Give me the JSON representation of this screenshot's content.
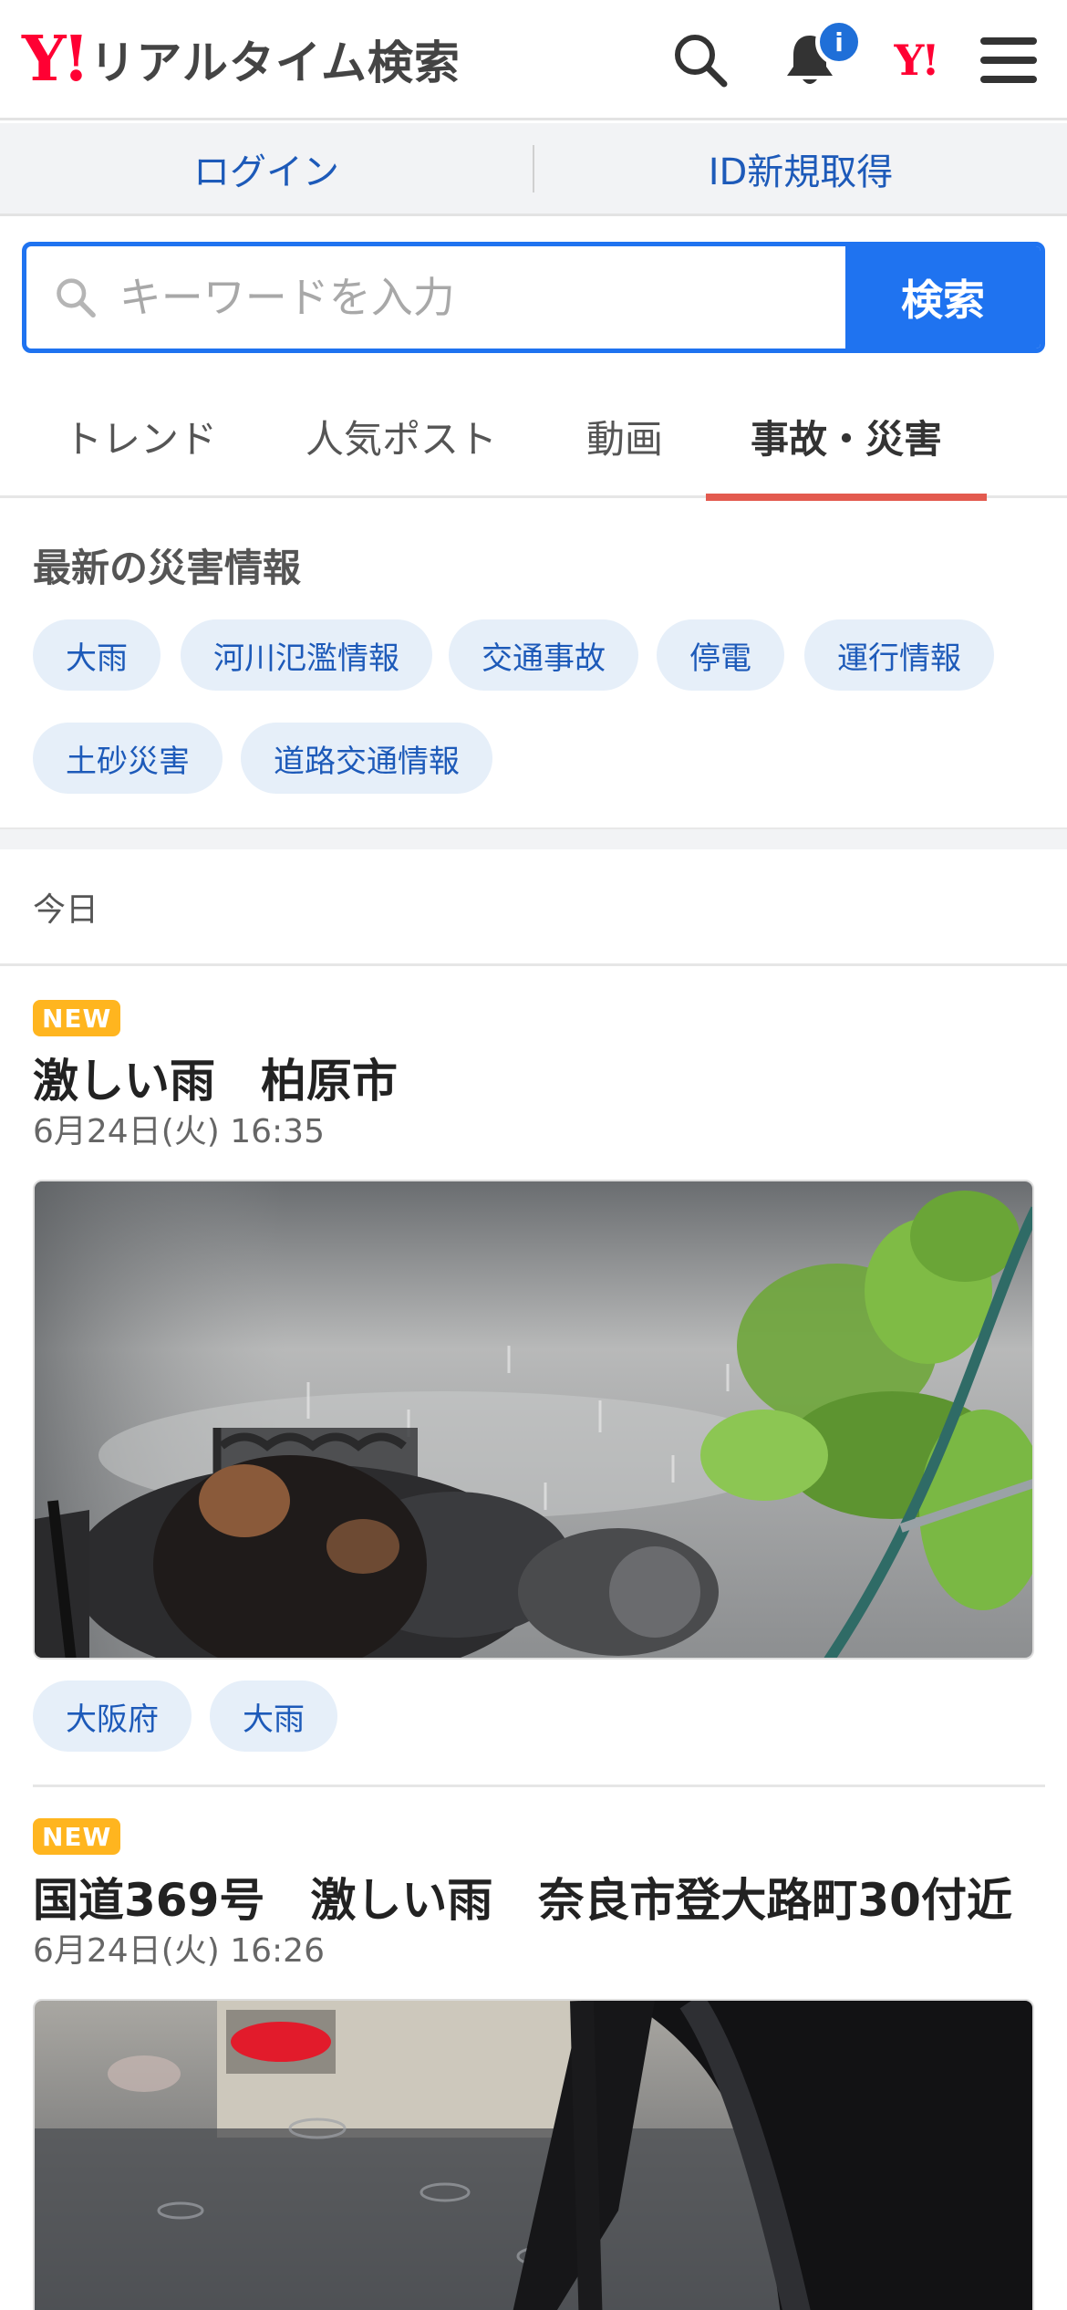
{
  "header": {
    "logo_mark": "Y!",
    "logo_text": "リアルタイム検索",
    "notification_badge": "i",
    "yahoo_mini": "Y!"
  },
  "auth": {
    "login": "ログイン",
    "register": "ID新規取得"
  },
  "search": {
    "placeholder": "キーワードを入力",
    "button": "検索"
  },
  "tabs": [
    "トレンド",
    "人気ポスト",
    "動画",
    "事故・災害"
  ],
  "active_tab": "事故・災害",
  "disaster": {
    "title": "最新の災害情報",
    "chips": [
      "大雨",
      "河川氾濫情報",
      "交通事故",
      "停電",
      "運行情報",
      "土砂災害",
      "道路交通情報"
    ]
  },
  "day_label": "今日",
  "posts": [
    {
      "badge": "NEW",
      "title": "激しい雨　柏原市",
      "date": "6月24日(火) 16:35",
      "tags": [
        "大阪府",
        "大雨"
      ]
    },
    {
      "badge": "NEW",
      "title": "国道369号　激しい雨　奈良市登大路町30付近",
      "date": "6月24日(火) 16:26",
      "tags": []
    }
  ],
  "colors": {
    "brand_red": "#ff0033",
    "link_blue": "#1d5ab9",
    "search_blue": "#1f73f0",
    "active_tab_underline": "#e35a4f",
    "chip_bg": "#e6eff9",
    "new_badge": "#ffb51f"
  }
}
